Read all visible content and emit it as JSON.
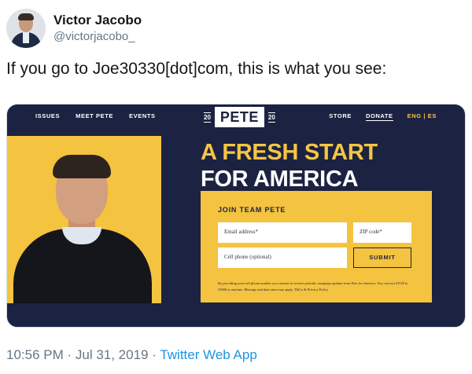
{
  "tweet": {
    "display_name": "Victor Jacobo",
    "handle": "@victorjacobo_",
    "text": "If you go to Joe30330[dot]com, this is what you see:",
    "timestamp": "10:56 PM · Jul 31, 2019 · ",
    "source_app": "Twitter Web App"
  },
  "site": {
    "nav_left": [
      "ISSUES",
      "MEET PETE",
      "EVENTS"
    ],
    "nav_right": [
      "STORE",
      "DONATE",
      "ENG | ES"
    ],
    "logo": {
      "year_left": "20",
      "word": "PETE",
      "year_right": "20"
    },
    "headline_accent": "A FRESH START",
    "headline_rest": "FOR AMERICA",
    "form": {
      "title": "JOIN TEAM PETE",
      "email_placeholder": "Email address*",
      "zip_placeholder": "ZIP code*",
      "phone_placeholder": "Cell phone (optional)",
      "submit_label": "SUBMIT",
      "fine_print": "By providing your cell phone number you consent to receive periodic campaign updates from Pete for America. You can text STOP to 25000 at anytime. Message and data rates may apply. T&Cs & Privacy Policy"
    }
  },
  "colors": {
    "navy": "#1c2241",
    "gold": "#f4c33f",
    "accent_yellow": "#f5c544",
    "link_blue": "#1b95e0"
  },
  "icons": [
    "avatar"
  ]
}
